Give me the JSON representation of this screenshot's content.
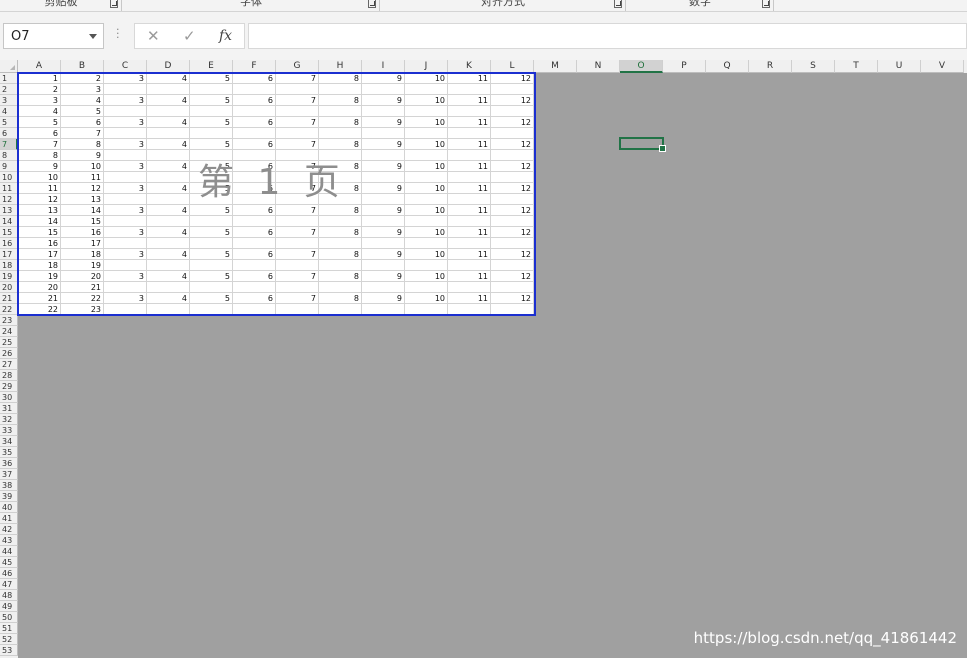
{
  "ribbon_groups": [
    {
      "id": "clipboard",
      "label": "剪贴板"
    },
    {
      "id": "font",
      "label": "字体"
    },
    {
      "id": "alignment",
      "label": "对齐方式"
    },
    {
      "id": "number",
      "label": "数字"
    }
  ],
  "formula_bar": {
    "name_box": "O7",
    "cancel_icon": "x-icon",
    "enter_icon": "check-icon",
    "fx_label": "fx",
    "formula": ""
  },
  "columns": [
    "A",
    "B",
    "C",
    "D",
    "E",
    "F",
    "G",
    "H",
    "I",
    "J",
    "K",
    "L",
    "M",
    "N",
    "O",
    "P",
    "Q",
    "R",
    "S",
    "T",
    "U",
    "V"
  ],
  "active_column": "O",
  "active_row": 7,
  "row_count": 53,
  "sheet": {
    "rows": [
      [
        1,
        2,
        3,
        4,
        5,
        6,
        7,
        8,
        9,
        10,
        11,
        12
      ],
      [
        2,
        3
      ],
      [
        3,
        4,
        3,
        4,
        5,
        6,
        7,
        8,
        9,
        10,
        11,
        12
      ],
      [
        4,
        5
      ],
      [
        5,
        6,
        3,
        4,
        5,
        6,
        7,
        8,
        9,
        10,
        11,
        12
      ],
      [
        6,
        7
      ],
      [
        7,
        8,
        3,
        4,
        5,
        6,
        7,
        8,
        9,
        10,
        11,
        12
      ],
      [
        8,
        9
      ],
      [
        9,
        10,
        3,
        4,
        5,
        6,
        7,
        8,
        9,
        10,
        11,
        12
      ],
      [
        10,
        11
      ],
      [
        11,
        12,
        3,
        4,
        5,
        6,
        7,
        8,
        9,
        10,
        11,
        12
      ],
      [
        12,
        13
      ],
      [
        13,
        14,
        3,
        4,
        5,
        6,
        7,
        8,
        9,
        10,
        11,
        12
      ],
      [
        14,
        15
      ],
      [
        15,
        16,
        3,
        4,
        5,
        6,
        7,
        8,
        9,
        10,
        11,
        12
      ],
      [
        16,
        17
      ],
      [
        17,
        18,
        3,
        4,
        5,
        6,
        7,
        8,
        9,
        10,
        11,
        12
      ],
      [
        18,
        19
      ],
      [
        19,
        20,
        3,
        4,
        5,
        6,
        7,
        8,
        9,
        10,
        11,
        12
      ],
      [
        20,
        21
      ],
      [
        21,
        22,
        3,
        4,
        5,
        6,
        7,
        8,
        9,
        10,
        11,
        12
      ],
      [
        22,
        23
      ]
    ]
  },
  "page_break_label": "第 1 页",
  "watermark": "https://blog.csdn.net/qq_41861442",
  "colors": {
    "print_area_border": "#1b2fd0",
    "selection": "#217346",
    "background": "#a0a0a0"
  }
}
